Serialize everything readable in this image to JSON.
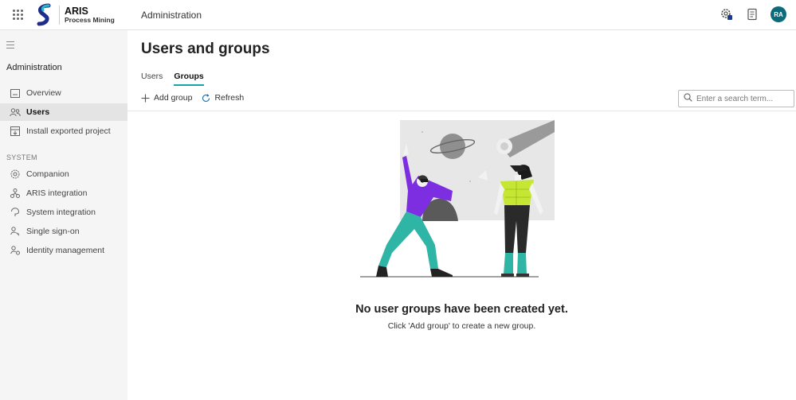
{
  "header": {
    "brand_title": "ARIS",
    "brand_subtitle": "Process Mining",
    "section_title": "Administration",
    "avatar_initials": "RA"
  },
  "sidebar": {
    "heading": "Administration",
    "items": [
      {
        "label": "Overview",
        "icon": "overview-icon"
      },
      {
        "label": "Users",
        "icon": "users-icon",
        "active": true
      },
      {
        "label": "Install exported project",
        "icon": "install-package-icon"
      }
    ],
    "system_section_label": "SYSTEM",
    "system_items": [
      {
        "label": "Companion",
        "icon": "companion-icon"
      },
      {
        "label": "ARIS integration",
        "icon": "aris-integration-icon"
      },
      {
        "label": "System integration",
        "icon": "system-integration-icon"
      },
      {
        "label": "Single sign-on",
        "icon": "single-sign-on-icon"
      },
      {
        "label": "Identity management",
        "icon": "identity-management-icon"
      }
    ]
  },
  "main": {
    "title": "Users and groups",
    "tabs": [
      {
        "label": "Users",
        "active": false
      },
      {
        "label": "Groups",
        "active": true
      }
    ],
    "toolbar": {
      "add_label": "Add group",
      "refresh_label": "Refresh"
    },
    "search": {
      "placeholder": "Enter a search term...",
      "value": ""
    },
    "empty_state": {
      "title": "No user groups have been created yet.",
      "subtitle": "Click 'Add group' to create a new group."
    }
  },
  "colors": {
    "accent": "#1aa3a3",
    "avatar_bg": "#0b6b7a",
    "sidebar_bg": "#f5f5f5",
    "sidebar_active_bg": "#e4e4e4"
  }
}
